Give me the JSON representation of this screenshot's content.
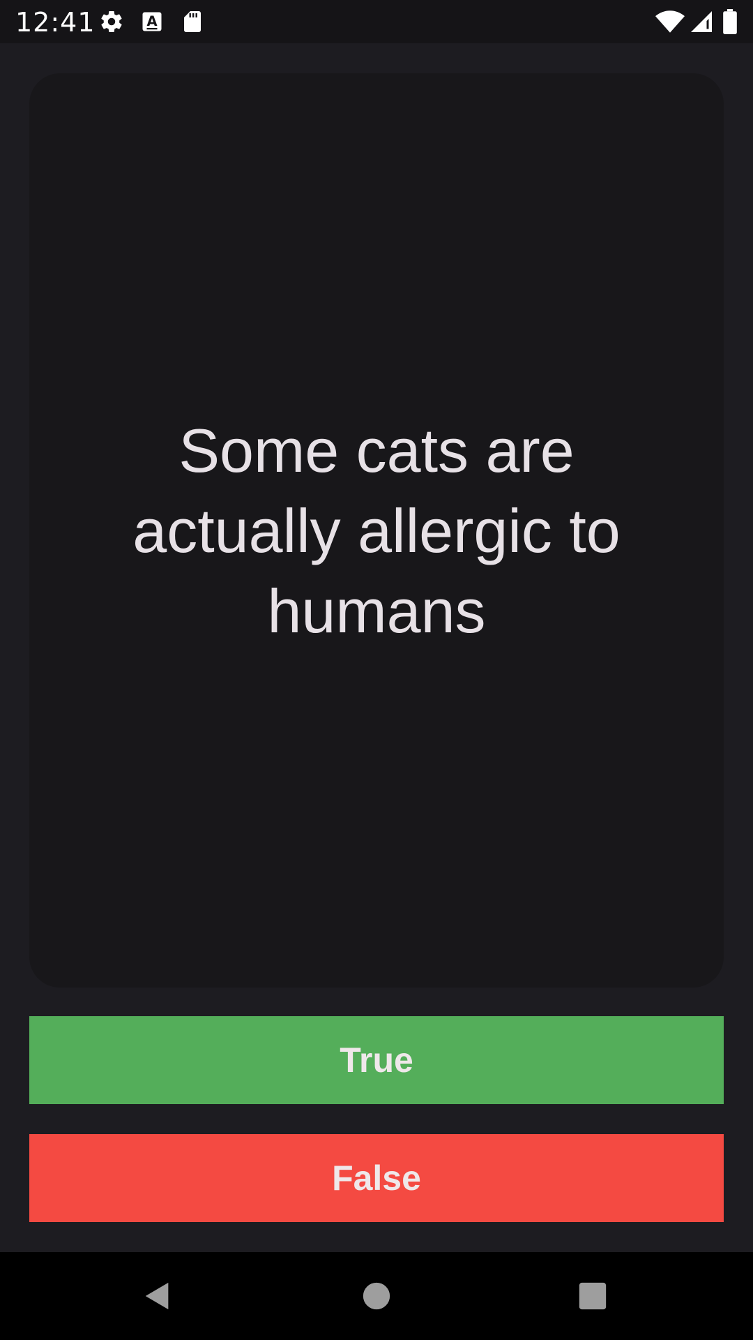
{
  "status_bar": {
    "time": "12:41",
    "left_icons": [
      "gear-icon",
      "text-a-icon",
      "sd-card-icon"
    ],
    "right_icons": [
      "wifi-icon",
      "signal-icon",
      "battery-icon"
    ]
  },
  "quiz": {
    "question": "Some cats are actually allergic to humans",
    "true_label": "True",
    "false_label": "False"
  },
  "nav_bar": {
    "icons": [
      "back-icon",
      "home-icon",
      "recents-icon"
    ]
  },
  "colors": {
    "background": "#1d1c21",
    "card": "#18171a",
    "text": "#e7e1e6",
    "true_button": "#54ae5a",
    "false_button": "#f44a42"
  }
}
